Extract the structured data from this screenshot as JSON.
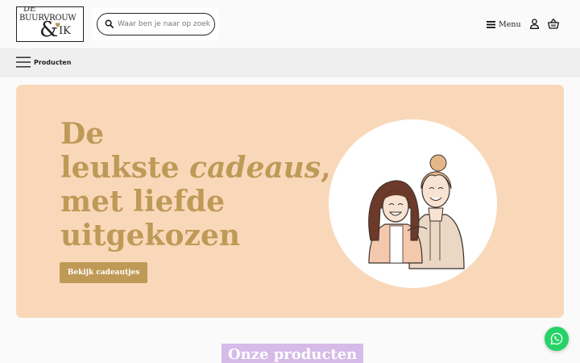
{
  "header": {
    "logo": {
      "line1": "DE",
      "line2": "BUURVROUW",
      "amp": "&",
      "line3": "IK"
    },
    "search": {
      "placeholder": "Waar ben je naar op zoek"
    },
    "menu_label": "Menu",
    "icons": {
      "search": "search-icon",
      "menu": "hamburger-icon",
      "account": "user-icon",
      "cart": "basket-icon"
    }
  },
  "nav": {
    "products_label": "Producten",
    "icon": "hamburger-icon"
  },
  "hero": {
    "title_line1": "De",
    "title_line2_a": "leukste ",
    "title_line2_em": "cadeaus",
    "title_line2_b": ",",
    "title_line3": "met liefde",
    "title_line4": "uitgekozen",
    "cta_label": "Bekijk cadeautjes",
    "illustration": "two-women-illustration"
  },
  "section": {
    "title": "Onze producten"
  },
  "floating": {
    "whatsapp_icon": "whatsapp-icon"
  },
  "colors": {
    "accent": "#bf9a57",
    "hero_background": "#f9d8ba",
    "section_title_background": "#d6bbe8",
    "whatsapp": "#25d366"
  }
}
